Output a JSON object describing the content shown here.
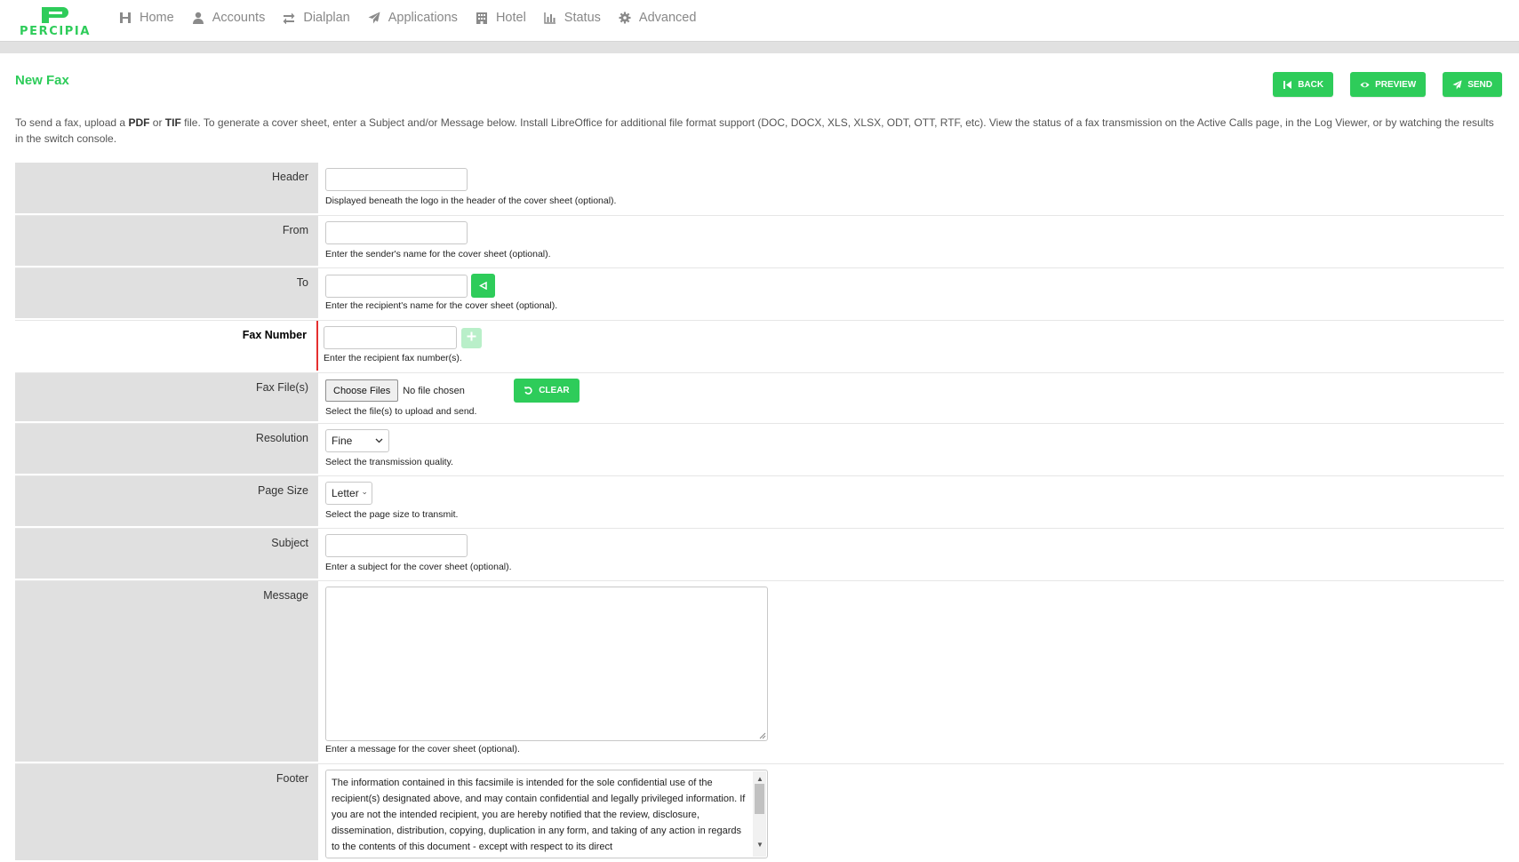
{
  "brand": {
    "name": "PERCIPIA",
    "color": "#2ecc5a"
  },
  "nav": [
    {
      "label": "Home",
      "icon": "home-icon"
    },
    {
      "label": "Accounts",
      "icon": "user-icon"
    },
    {
      "label": "Dialplan",
      "icon": "exchange-arrows-icon"
    },
    {
      "label": "Applications",
      "icon": "paper-plane-icon"
    },
    {
      "label": "Hotel",
      "icon": "building-icon"
    },
    {
      "label": "Status",
      "icon": "bar-chart-icon"
    },
    {
      "label": "Advanced",
      "icon": "gear-icon"
    }
  ],
  "page": {
    "title": "New Fax",
    "buttons": {
      "back": "BACK",
      "preview": "PREVIEW",
      "send": "SEND"
    },
    "intro": {
      "p1": "To send a fax, upload a ",
      "pdf": "PDF",
      "p2": " or ",
      "tif": "TIF",
      "p3": " file. To generate a cover sheet, enter a Subject and/or Message below. Install LibreOffice for additional file format support (DOC, DOCX, XLS, XLSX, ODT, OTT, RTF, etc). View the status of a fax transmission on the Active Calls page, in the Log Viewer, or by watching the results in the switch console."
    }
  },
  "form": {
    "header": {
      "label": "Header",
      "value": "",
      "desc": "Displayed beneath the logo in the header of the cover sheet (optional)."
    },
    "from": {
      "label": "From",
      "value": "",
      "desc": "Enter the sender's name for the cover sheet (optional)."
    },
    "to": {
      "label": "To",
      "value": "",
      "desc": "Enter the recipient's name for the cover sheet (optional)."
    },
    "fax_number": {
      "label": "Fax Number",
      "value": "",
      "desc": "Enter the recipient fax number(s)."
    },
    "fax_files": {
      "label": "Fax File(s)",
      "choose": "Choose Files",
      "status": "No file chosen",
      "clear": "CLEAR",
      "desc": "Select the file(s) to upload and send."
    },
    "resolution": {
      "label": "Resolution",
      "selected": "Fine",
      "desc": "Select the transmission quality."
    },
    "page_size": {
      "label": "Page Size",
      "selected": "Letter",
      "desc": "Select the page size to transmit."
    },
    "subject": {
      "label": "Subject",
      "value": "",
      "desc": "Enter a subject for the cover sheet (optional)."
    },
    "message": {
      "label": "Message",
      "value": "",
      "desc": "Enter a message for the cover sheet (optional)."
    },
    "footer": {
      "label": "Footer",
      "value": "The information contained in this facsimile is intended for the sole confidential use of the recipient(s) designated above, and may contain confidential and legally privileged information. If you are not the intended recipient, you are hereby notified that the review, disclosure, dissemination, distribution, copying, duplication in any form, and taking of any action in regards to the contents of this document - except with respect to its direct"
    }
  }
}
